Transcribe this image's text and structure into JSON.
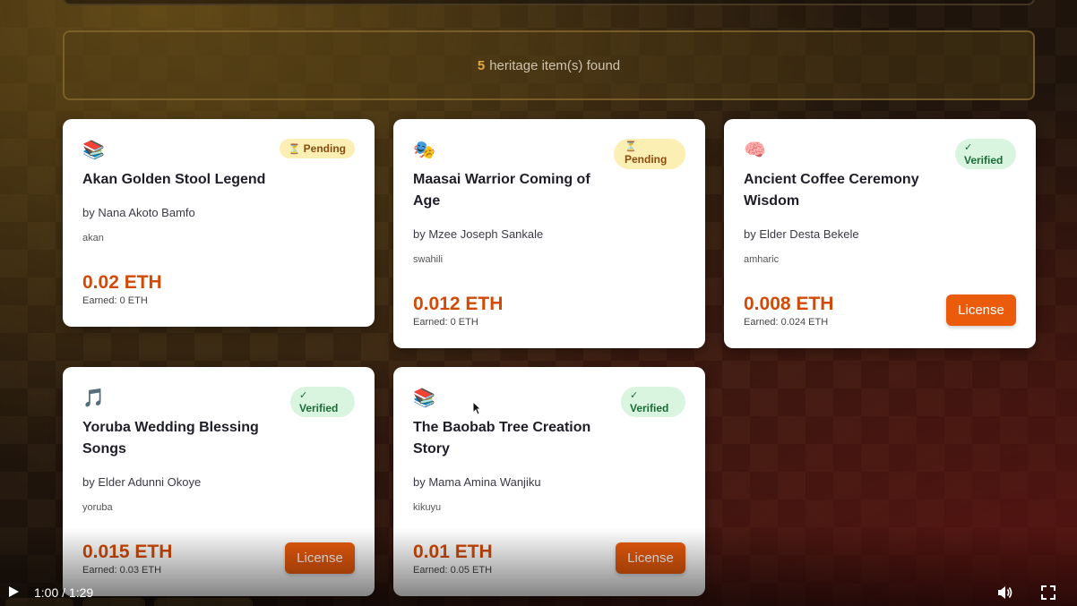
{
  "results": {
    "count": "5",
    "text": "heritage item(s) found"
  },
  "cards": [
    {
      "icon": "📚",
      "icon_name": "books-icon",
      "status_icon": "⏳",
      "status": "Pending",
      "title_lines": [
        "Akan Golden Stool Legend"
      ],
      "author": "by Nana Akoto Bamfo",
      "language": "akan",
      "price": "0.02 ETH",
      "earned": "Earned: 0 ETH"
    },
    {
      "icon": "🎭",
      "icon_name": "performing-arts-icon",
      "status_icon": "⏳",
      "status": "Pending",
      "title_lines": [
        "Maasai Warrior Coming of",
        "Age"
      ],
      "author": "by Mzee Joseph Sankale",
      "language": "swahili",
      "price": "0.012 ETH",
      "earned": "Earned: 0 ETH"
    },
    {
      "icon": "🧠",
      "icon_name": "brain-icon",
      "status_icon": "✓",
      "status": "Verified",
      "title_lines": [
        "Ancient Coffee Ceremony",
        "Wisdom"
      ],
      "author": "by Elder Desta Bekele",
      "language": "amharic",
      "price": "0.008 ETH",
      "earned": "Earned: 0.024 ETH",
      "button": "License"
    },
    {
      "icon": "🎵",
      "icon_name": "music-note-icon",
      "status_icon": "✓",
      "status": "Verified",
      "title_lines": [
        "Yoruba Wedding Blessing",
        "Songs"
      ],
      "author": "by Elder Adunni Okoye",
      "language": "yoruba",
      "price": "0.015 ETH",
      "earned": "Earned: 0.03 ETH",
      "button": "License"
    },
    {
      "icon": "📚",
      "icon_name": "books-icon",
      "status_icon": "✓",
      "status": "Verified",
      "title_lines": [
        "The Baobab Tree Creation",
        "Story"
      ],
      "author": "by Mama Amina Wanjiku",
      "language": "kikuyu",
      "price": "0.01 ETH",
      "earned": "Earned: 0.05 ETH",
      "button": "License"
    }
  ],
  "video": {
    "time": "1:00 / 1:29"
  },
  "colors": {
    "accent": "#ea5b0c",
    "price": "#d24a05",
    "pending_bg": "#fbefb3",
    "verified_bg": "#d9f5e0"
  }
}
